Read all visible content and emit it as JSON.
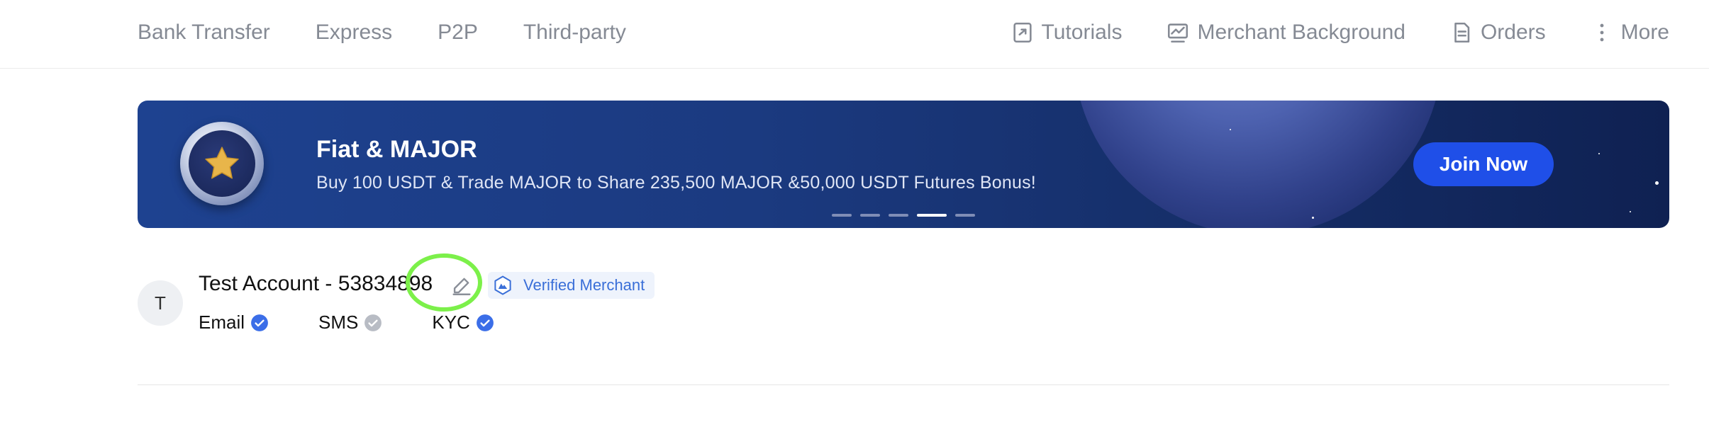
{
  "nav": {
    "left": [
      "Bank Transfer",
      "Express",
      "P2P",
      "Third-party"
    ],
    "right": [
      {
        "label": "Tutorials",
        "icon": "tutorials-icon"
      },
      {
        "label": "Merchant Background",
        "icon": "chart-icon"
      },
      {
        "label": "Orders",
        "icon": "orders-icon"
      },
      {
        "label": "More",
        "icon": "more-vertical-icon"
      }
    ]
  },
  "banner": {
    "title": "Fiat & MAJOR",
    "subtitle": "Buy 100 USDT & Trade MAJOR to Share 235,500 MAJOR &50,000 USDT Futures Bonus!",
    "cta": "Join Now",
    "slides_total": 5,
    "active_slide": 4
  },
  "account": {
    "avatar_letter": "T",
    "name": "Test Account - 53834898",
    "badge": "Verified Merchant",
    "checks": [
      {
        "label": "Email",
        "verified": true
      },
      {
        "label": "SMS",
        "verified": false
      },
      {
        "label": "KYC",
        "verified": true
      }
    ]
  },
  "colors": {
    "accent": "#1f4fe8",
    "nav_text": "#858a94",
    "check_verified": "#3b6ee8",
    "check_unverified": "#b8bcc4",
    "highlight": "#7cf04a"
  }
}
